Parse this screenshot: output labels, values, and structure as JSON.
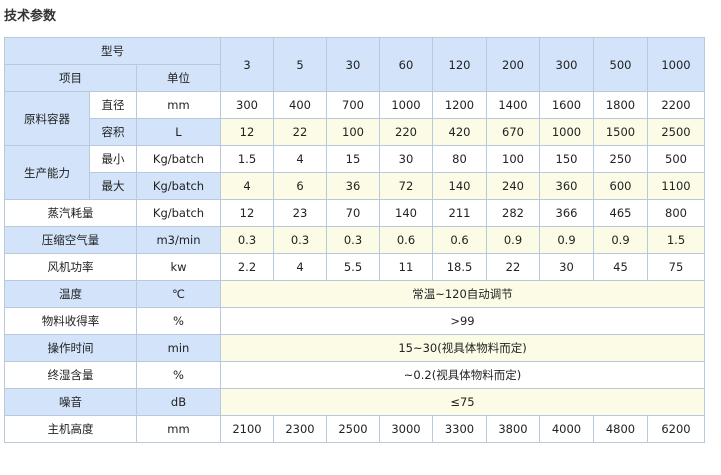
{
  "heading": "技术参数",
  "header": {
    "model_label": "型号",
    "item_label": "项目",
    "unit_label": "单位",
    "models": [
      "3",
      "5",
      "30",
      "60",
      "120",
      "200",
      "300",
      "500",
      "1000"
    ]
  },
  "container": {
    "group": "原料容器",
    "diameter": {
      "label": "直径",
      "unit": "mm",
      "values": [
        "300",
        "400",
        "700",
        "1000",
        "1200",
        "1400",
        "1600",
        "1800",
        "2200"
      ]
    },
    "volume": {
      "label": "容积",
      "unit": "L",
      "values": [
        "12",
        "22",
        "100",
        "220",
        "420",
        "670",
        "1000",
        "1500",
        "2500"
      ]
    }
  },
  "capacity": {
    "group": "生产能力",
    "min": {
      "label": "最小",
      "unit": "Kg/batch",
      "values": [
        "1.5",
        "4",
        "15",
        "30",
        "80",
        "100",
        "150",
        "250",
        "500"
      ]
    },
    "max": {
      "label": "最大",
      "unit": "Kg/batch",
      "values": [
        "4",
        "6",
        "36",
        "72",
        "140",
        "240",
        "360",
        "600",
        "1100"
      ]
    }
  },
  "rows": {
    "steam": {
      "label": "蒸汽耗量",
      "unit": "Kg/batch",
      "values": [
        "12",
        "23",
        "70",
        "140",
        "211",
        "282",
        "366",
        "465",
        "800"
      ]
    },
    "air": {
      "label": "压缩空气量",
      "unit": "m3/min",
      "values": [
        "0.3",
        "0.3",
        "0.3",
        "0.6",
        "0.6",
        "0.9",
        "0.9",
        "0.9",
        "1.5"
      ]
    },
    "fan": {
      "label": "风机功率",
      "unit": "kw",
      "values": [
        "2.2",
        "4",
        "5.5",
        "11",
        "18.5",
        "22",
        "30",
        "45",
        "75"
      ]
    },
    "temp": {
      "label": "温度",
      "unit": "℃",
      "value": "常温~120自动调节"
    },
    "yield": {
      "label": "物料收得率",
      "unit": "%",
      "value": ">99"
    },
    "optime": {
      "label": "操作时间",
      "unit": "min",
      "value": "15~30(视具体物料而定)"
    },
    "moisture": {
      "label": "终湿含量",
      "unit": "%",
      "value": "~0.2(视具体物料而定)"
    },
    "noise": {
      "label": "噪音",
      "unit": "dB",
      "value": "≤75"
    },
    "height": {
      "label": "主机高度",
      "unit": "mm",
      "values": [
        "2100",
        "2300",
        "2500",
        "3000",
        "3300",
        "3800",
        "4000",
        "4800",
        "6200"
      ]
    }
  }
}
